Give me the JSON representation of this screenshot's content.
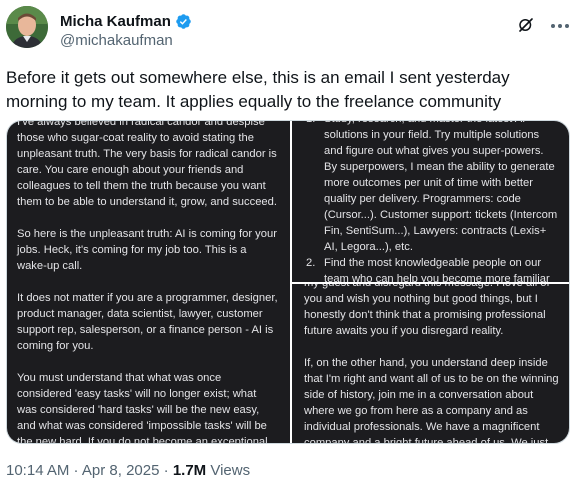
{
  "author": {
    "display_name": "Micha Kaufman",
    "handle": "@michakaufman",
    "verified": true,
    "avatar_icon": "profile-photo",
    "grok_icon": "grok-icon",
    "more_icon": "more-horizontal-icon"
  },
  "tweet": {
    "text": "Before it gets out somewhere else, this is an email I sent yesterday morning to my team. It applies equally to the freelance community"
  },
  "email_left": {
    "paragraphs": [
      "I've always believed in radical candor and despise those who sugar-coat reality to avoid stating the unpleasant truth. The very basis for radical candor is care. You care enough about your friends and colleagues to tell them the truth because you want them to be able to understand it, grow, and succeed.",
      "So here is the unpleasant truth: AI is coming for your jobs. Heck, it's coming for my job too. This is a wake-up call.",
      "It does not matter if you are a programmer, designer, product manager, data scientist, lawyer, customer support rep, salesperson, or a finance person - AI is coming for you.",
      "You must understand that what was once considered 'easy tasks' will no longer exist; what was considered 'hard tasks' will be the new easy, and what was considered 'impossible tasks' will be the new hard. If you do not become an exceptional talent at what you"
    ]
  },
  "email_top_right": {
    "items": [
      {
        "num": "1.",
        "text": "Study, research, and master the latest AI solutions in your field. Try multiple solutions and figure out what gives you super-powers. By superpowers, I mean the ability to generate more outcomes per unit of time with better quality per delivery. Programmers: code (Cursor...). Customer support: tickets (Intercom Fin, SentiSum...), Lawyers: contracts (Lexis+ AI, Legora...), etc."
      },
      {
        "num": "2.",
        "text": "Find the most knowledgeable people on our team who can help you become more familiar with the latest and greatest in AI"
      }
    ]
  },
  "email_bottom_right": {
    "paragraphs": [
      "my guest and disregard this message. I love all of you and wish you nothing but good things, but I honestly don't think that a promising professional future awaits you if you disregard reality.",
      "If, on the other hand, you understand deep inside that I'm right and want all of us to be on the winning side of history, join me in a conversation about where we go from here as a company and as individual professionals. We have a magnificent company and a bright future ahead of us. We just need to wake up"
    ]
  },
  "meta": {
    "time": "10:14 AM",
    "separator1": " · ",
    "date": "Apr 8, 2025",
    "separator2": " · ",
    "views_count": "1.7M",
    "views_label": " Views"
  },
  "colors": {
    "verified_badge": "#1d9bf0",
    "pane_background": "#1c1c1f",
    "secondary_text": "#536471"
  }
}
